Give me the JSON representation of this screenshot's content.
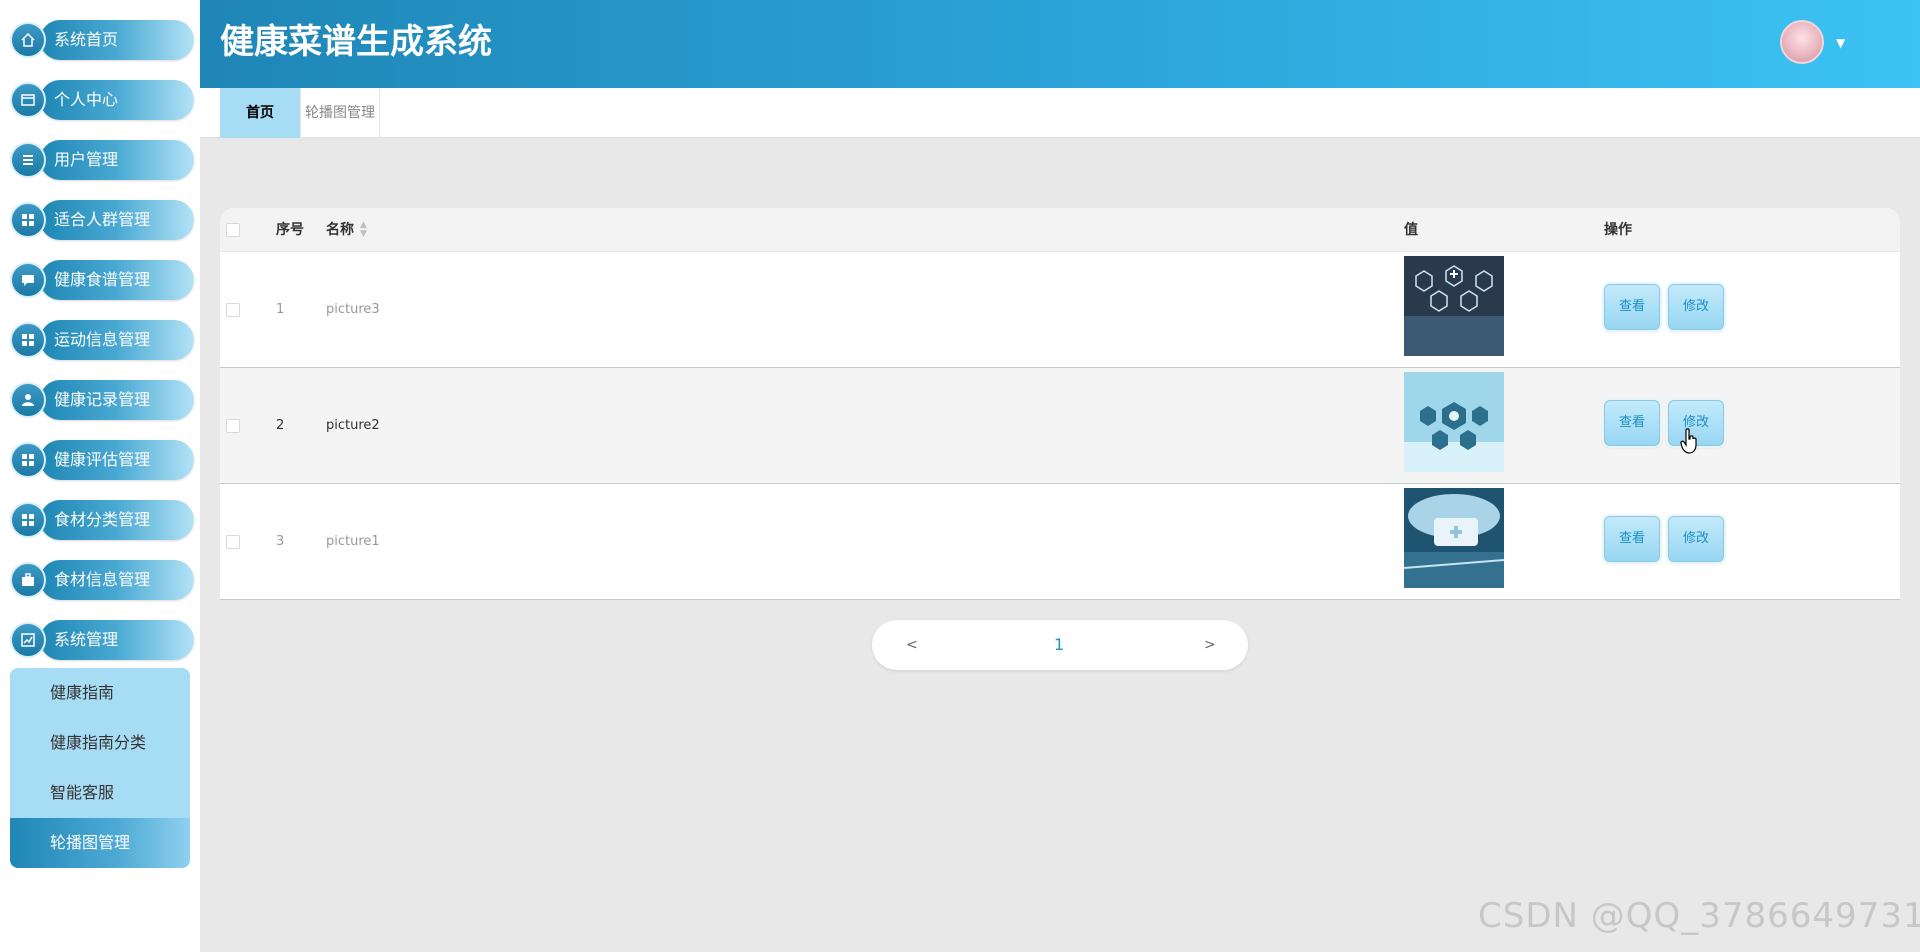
{
  "app": {
    "title": "健康菜谱生成系统"
  },
  "sidebar": {
    "items": [
      {
        "label": "系统首页",
        "icon": "home-icon"
      },
      {
        "label": "个人中心",
        "icon": "profile-card-icon"
      },
      {
        "label": "用户管理",
        "icon": "list-icon"
      },
      {
        "label": "适合人群管理",
        "icon": "grid-icon"
      },
      {
        "label": "健康食谱管理",
        "icon": "chat-icon"
      },
      {
        "label": "运动信息管理",
        "icon": "grid-icon"
      },
      {
        "label": "健康记录管理",
        "icon": "user-icon"
      },
      {
        "label": "健康评估管理",
        "icon": "grid-icon"
      },
      {
        "label": "食材分类管理",
        "icon": "grid-icon"
      },
      {
        "label": "食材信息管理",
        "icon": "briefcase-icon"
      },
      {
        "label": "系统管理",
        "icon": "chart-icon"
      }
    ],
    "submenu": [
      {
        "label": "健康指南"
      },
      {
        "label": "健康指南分类"
      },
      {
        "label": "智能客服"
      },
      {
        "label": "轮播图管理",
        "active": true
      }
    ]
  },
  "tabs": [
    {
      "label": "首页",
      "active": true
    },
    {
      "label": "轮播图管理",
      "active": false
    }
  ],
  "table": {
    "columns": {
      "index": "序号",
      "name": "名称",
      "value": "值",
      "actions": "操作"
    },
    "rows": [
      {
        "index": "1",
        "name": "picture3",
        "view": "查看",
        "edit": "修改"
      },
      {
        "index": "2",
        "name": "picture2",
        "view": "查看",
        "edit": "修改"
      },
      {
        "index": "3",
        "name": "picture1",
        "view": "查看",
        "edit": "修改"
      }
    ]
  },
  "pagination": {
    "prev": "<",
    "current": "1",
    "next": ">"
  },
  "watermark": "CSDN @QQ_3786649731",
  "colors": {
    "header_start": "#1f86b6",
    "header_end": "#3cc3f3",
    "accent_light": "#a7dcf5"
  }
}
